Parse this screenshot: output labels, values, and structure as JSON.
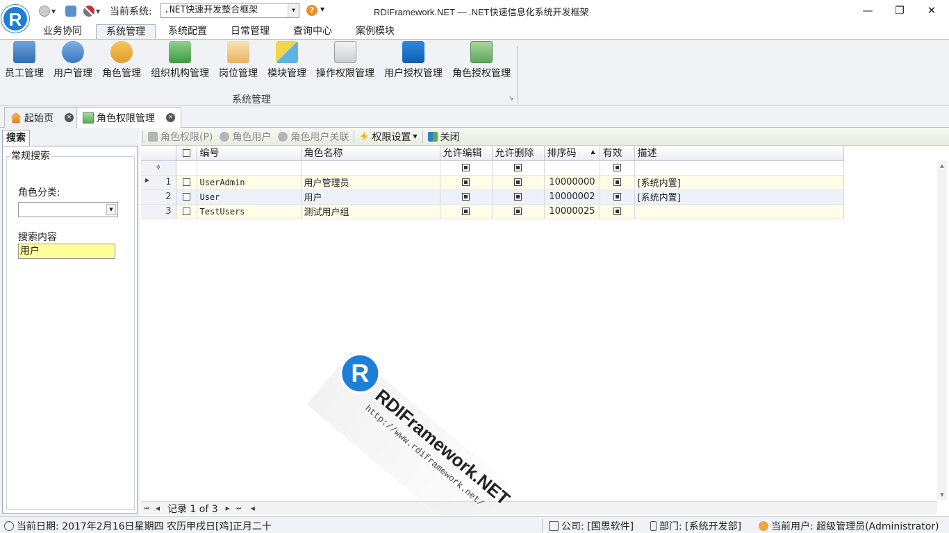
{
  "titlebar": {
    "logo_letter": "R",
    "current_system_label": "当前系统:",
    "current_system_value": ".NET快速开发整合框架",
    "window_title": "RDIFramework.NET — .NET快速信息化系统开发框架",
    "minimize": "—",
    "restore": "❐",
    "close": "✕"
  },
  "menu": {
    "tabs": [
      "业务协同",
      "系统管理",
      "系统配置",
      "日常管理",
      "查询中心",
      "案例模块"
    ],
    "active": "系统管理"
  },
  "ribbon": {
    "buttons": [
      "员工管理",
      "用户管理",
      "角色管理",
      "组织机构管理",
      "岗位管理",
      "模块管理",
      "操作权限管理",
      "用户授权管理",
      "角色授权管理"
    ],
    "group_label": "系统管理",
    "launcher": "↘"
  },
  "doctabs": {
    "home": "起始页",
    "current": "角色权限管理",
    "close_glyph": "×"
  },
  "search_panel": {
    "tab": "搜索",
    "group": "常规搜索",
    "category_label": "角色分类:",
    "category_value": "",
    "content_label": "搜索内容",
    "content_value": "用户"
  },
  "toolbar": {
    "role_permission": "角色权限(P)",
    "role_users": "角色用户",
    "role_user_link": "角色用户关联",
    "permission_settings": "权限设置",
    "close": "关闭"
  },
  "grid": {
    "columns": [
      "编号",
      "角色名称",
      "允许编辑",
      "允许删除",
      "排序码",
      "有效",
      "描述"
    ],
    "rows": [
      {
        "index": "1",
        "code": "UserAdmin",
        "name": "用户管理员",
        "sort": "10000000",
        "desc": "[系统内置]"
      },
      {
        "index": "2",
        "code": "User",
        "name": "用户",
        "sort": "10000002",
        "desc": "[系统内置]"
      },
      {
        "index": "3",
        "code": "TestUsers",
        "name": "测试用户组",
        "sort": "10000025",
        "desc": ""
      }
    ]
  },
  "watermark": {
    "logo_letter": "R",
    "brand": "RDIFramework.NET",
    "url": "http://www.rdiframework.net/"
  },
  "navigator": {
    "text": "记录 1 of 3"
  },
  "statusbar": {
    "date": "当前日期: 2017年2月16日星期四 农历甲戌日[鸡]正月二十",
    "company": "公司: [国思软件]",
    "department": "部门: [系统开发部]",
    "user": "当前用户: 超级管理员(Administrator)"
  },
  "colors": {
    "brand_blue": "#1e7fd8",
    "search_highlight": "#ffff99",
    "row_odd": "#fffde8",
    "row_even": "#edf2fa"
  }
}
